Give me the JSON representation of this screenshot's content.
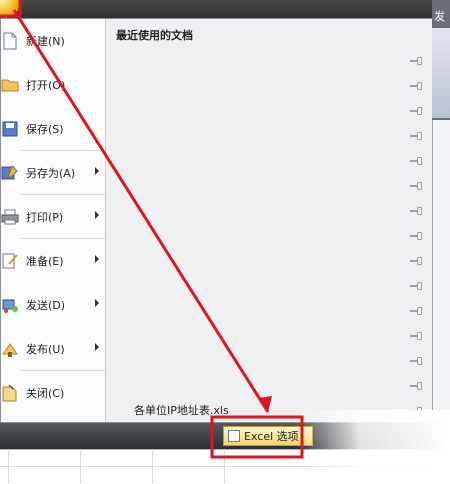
{
  "menu": {
    "items": [
      {
        "label": "新建(N)",
        "icon": "new-document-icon",
        "has_submenu": false
      },
      {
        "label": "打开(O)",
        "icon": "open-folder-icon",
        "has_submenu": false
      },
      {
        "label": "保存(S)",
        "icon": "save-icon",
        "has_submenu": false
      },
      {
        "label": "另存为(A)",
        "icon": "save-as-icon",
        "has_submenu": true
      },
      {
        "label": "打印(P)",
        "icon": "print-icon",
        "has_submenu": true
      },
      {
        "label": "准备(E)",
        "icon": "prepare-icon",
        "has_submenu": true
      },
      {
        "label": "发送(D)",
        "icon": "send-icon",
        "has_submenu": true
      },
      {
        "label": "发布(U)",
        "icon": "publish-icon",
        "has_submenu": true
      },
      {
        "label": "关闭(C)",
        "icon": "close-document-icon",
        "has_submenu": false
      }
    ],
    "recent_title": "最近使用的文档",
    "recent_files": [
      "各单位IP地址表.xls"
    ]
  },
  "bottom": {
    "excel_options_label": "Excel 选项"
  },
  "background_window": {
    "label": "发"
  },
  "colors": {
    "annotation_red": "#e0141e",
    "menu_bg": "#f5f6f7"
  }
}
